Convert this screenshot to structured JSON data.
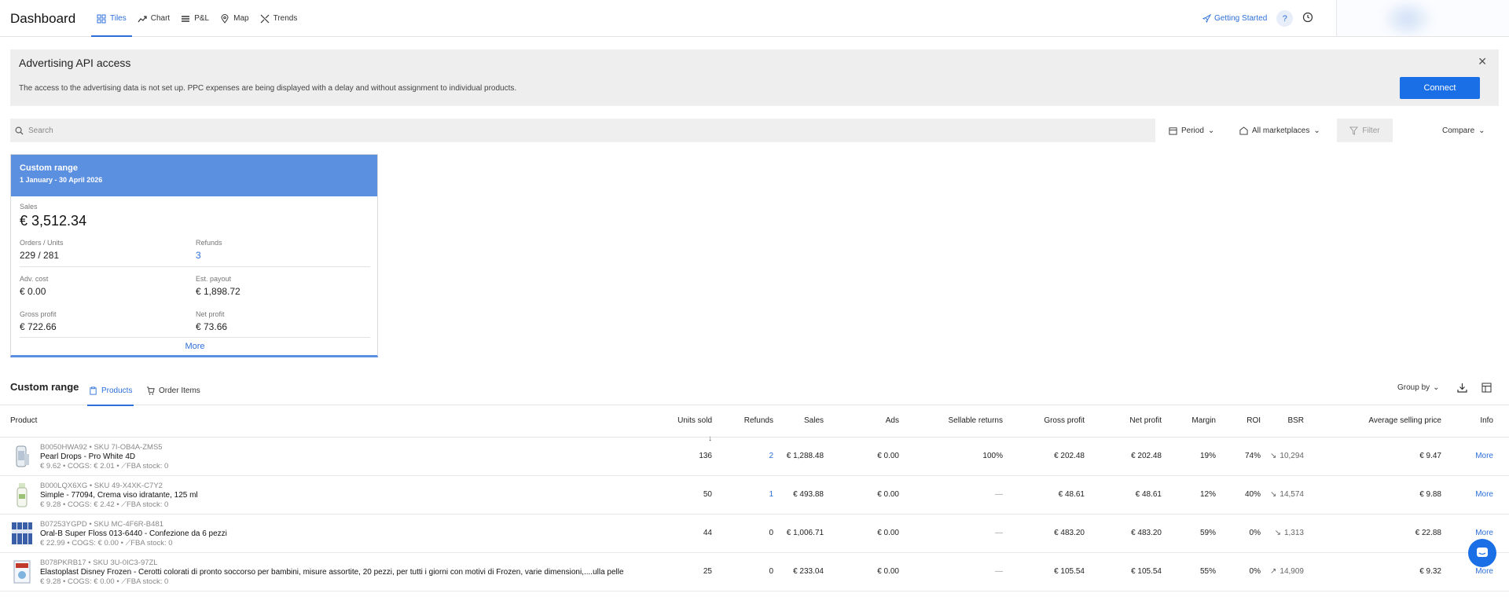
{
  "header": {
    "title": "Dashboard",
    "tabs": [
      {
        "label": "Tiles",
        "icon": "grid-icon"
      },
      {
        "label": "Chart",
        "icon": "trend-line-icon"
      },
      {
        "label": "P&L",
        "icon": "list-icon"
      },
      {
        "label": "Map",
        "icon": "map-pin-icon"
      },
      {
        "label": "Trends",
        "icon": "shuffle-icon"
      }
    ],
    "getting_started": "Getting Started",
    "help": "?"
  },
  "banner": {
    "title": "Advertising API access",
    "text": "The access to the advertising data is not set up. PPC expenses are being displayed with a delay and without assignment to individual products.",
    "connect_label": "Connect",
    "close": "✕"
  },
  "filters": {
    "search_placeholder": "Search",
    "period": "Period",
    "marketplaces": "All marketplaces",
    "filter": "Filter",
    "compare": "Compare"
  },
  "tile": {
    "title": "Custom range",
    "date_range": "1 January - 30 April 2026",
    "sales_label": "Sales",
    "sales_value": "€ 3,512.34",
    "orders_label": "Orders / Units",
    "orders_value": "229 / 281",
    "refunds_label": "Refunds",
    "refunds_value": "3",
    "adv_label": "Adv. cost",
    "adv_value": "€ 0.00",
    "payout_label": "Est. payout",
    "payout_value": "€ 1,898.72",
    "gross_label": "Gross profit",
    "gross_value": "€ 722.66",
    "net_label": "Net profit",
    "net_value": "€ 73.66",
    "more": "More"
  },
  "products_section": {
    "title": "Custom range",
    "tabs": [
      "Products",
      "Order Items"
    ],
    "group_by": "Group by"
  },
  "table": {
    "columns": {
      "product": "Product",
      "units": "Units sold",
      "refunds": "Refunds",
      "sales": "Sales",
      "ads": "Ads",
      "returns": "Sellable returns",
      "gross": "Gross profit",
      "net": "Net profit",
      "margin": "Margin",
      "roi": "ROI",
      "bsr": "BSR",
      "asp": "Average selling price",
      "info": "Info"
    },
    "rows": [
      {
        "meta1": "B0050HWA92 • SKU 7I-OB4A-ZMS5",
        "name": "Pearl Drops - Pro White 4D",
        "meta2": "€ 9.62 • COGS: € 2.01 • ⟋FBA stock: 0",
        "units": "136",
        "refunds": "2",
        "sales": "€ 1,288.48",
        "ads": "€ 0.00",
        "returns": "100%",
        "gross": "€ 202.48",
        "net": "€ 202.48",
        "margin": "19%",
        "roi": "74%",
        "bsr_dir": "↘",
        "bsr": "10,294",
        "asp": "€ 9.47",
        "info": "More"
      },
      {
        "meta1": "B000LQX6XG • SKU 49-X4XK-C7Y2",
        "name": "Simple - 77094, Crema viso idratante, 125 ml",
        "meta2": "€ 9.28 • COGS: € 2.42 • ⟋FBA stock: 0",
        "units": "50",
        "refunds": "1",
        "sales": "€ 493.88",
        "ads": "€ 0.00",
        "returns": "—",
        "gross": "€ 48.61",
        "net": "€ 48.61",
        "margin": "12%",
        "roi": "40%",
        "bsr_dir": "↘",
        "bsr": "14,574",
        "asp": "€ 9.88",
        "info": "More"
      },
      {
        "meta1": "B07253YGPD • SKU MC-4F6R-B481",
        "name": "Oral-B Super Floss 013-6440 - Confezione da 6 pezzi",
        "meta2": "€ 22.99 • COGS: € 0.00 • ⟋FBA stock: 0",
        "units": "44",
        "refunds": "0",
        "sales": "€ 1,006.71",
        "ads": "€ 0.00",
        "returns": "—",
        "gross": "€ 483.20",
        "net": "€ 483.20",
        "margin": "59%",
        "roi": "0%",
        "bsr_dir": "↘",
        "bsr": "1,313",
        "asp": "€ 22.88",
        "info": "More"
      },
      {
        "meta1": "B078PKRB17 • SKU 3U-0IC3-97ZL",
        "name": "Elastoplast Disney Frozen - Cerotti colorati di pronto soccorso per bambini, misure assortite, 20 pezzi, per tutti i giorni con motivi di Frozen, varie dimensioni,....ulla pelle",
        "meta2": "€ 9.28 • COGS: € 0.00 • ⟋FBA stock: 0",
        "units": "25",
        "refunds": "0",
        "sales": "€ 233.04",
        "ads": "€ 0.00",
        "returns": "—",
        "gross": "€ 105.54",
        "net": "€ 105.54",
        "margin": "55%",
        "roi": "0%",
        "bsr_dir": "↗",
        "bsr": "14,909",
        "asp": "€ 9.32",
        "info": "More"
      }
    ]
  },
  "colors": {
    "accent": "#2d6fd8",
    "button": "#1a6ee6",
    "tile_header": "#5b8fe0",
    "banner_bg": "#eeeeee"
  }
}
